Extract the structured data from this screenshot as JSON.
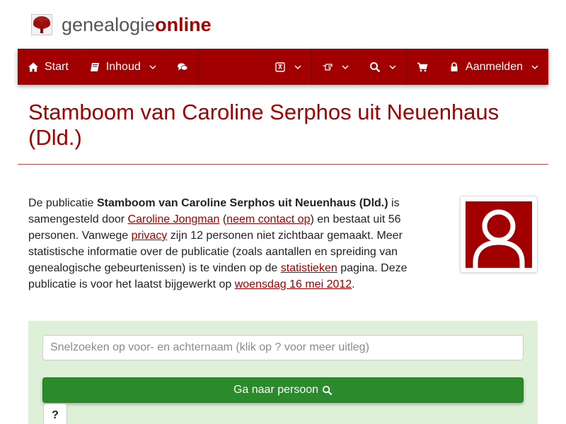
{
  "brand": {
    "part1": "genealogie",
    "part2": "online"
  },
  "nav": {
    "start": "Start",
    "inhoud": "Inhoud",
    "login": "Aanmelden",
    "icons": {
      "start": "home-icon",
      "inhoud": "book-icon",
      "forum": "comments-icon",
      "language": "language-icon",
      "share": "hand-pointing-icon",
      "search": "search-icon",
      "shop": "cart-icon",
      "login": "lock-icon"
    }
  },
  "page": {
    "title": "Stamboom van Caroline Serphos uit Neuenhaus (Dld.)"
  },
  "intro": {
    "t1": "De publicatie ",
    "pub_name": "Stamboom van Caroline Serphos uit Neuenhaus (Dld.)",
    "t2": " is samengesteld door ",
    "author": "Caroline Jongman",
    "t3": " (",
    "contact": "neem contact op",
    "t4": ") en bestaat uit 56 personen. Vanwege ",
    "privacy": "privacy",
    "t5": " zijn 12 personen niet zichtbaar gemaakt. Meer statistische informatie over de publicatie (zoals aantallen en spreiding van genealogische gebeurtenissen) is te vinden op de ",
    "stats": "statistieken",
    "t6": " pagina. Deze publicatie is voor het laatst bijgewerkt op ",
    "date": "woensdag 16 mei 2012",
    "t7": "."
  },
  "search": {
    "placeholder": "Snelzoeken op voor- en achternaam (klik op ? voor meer uitleg)",
    "button": "Ga naar persoon",
    "help": "?"
  },
  "colors": {
    "brand": "#a20000",
    "panel": "#dff0d8",
    "go_button": "#2b8a2b"
  }
}
